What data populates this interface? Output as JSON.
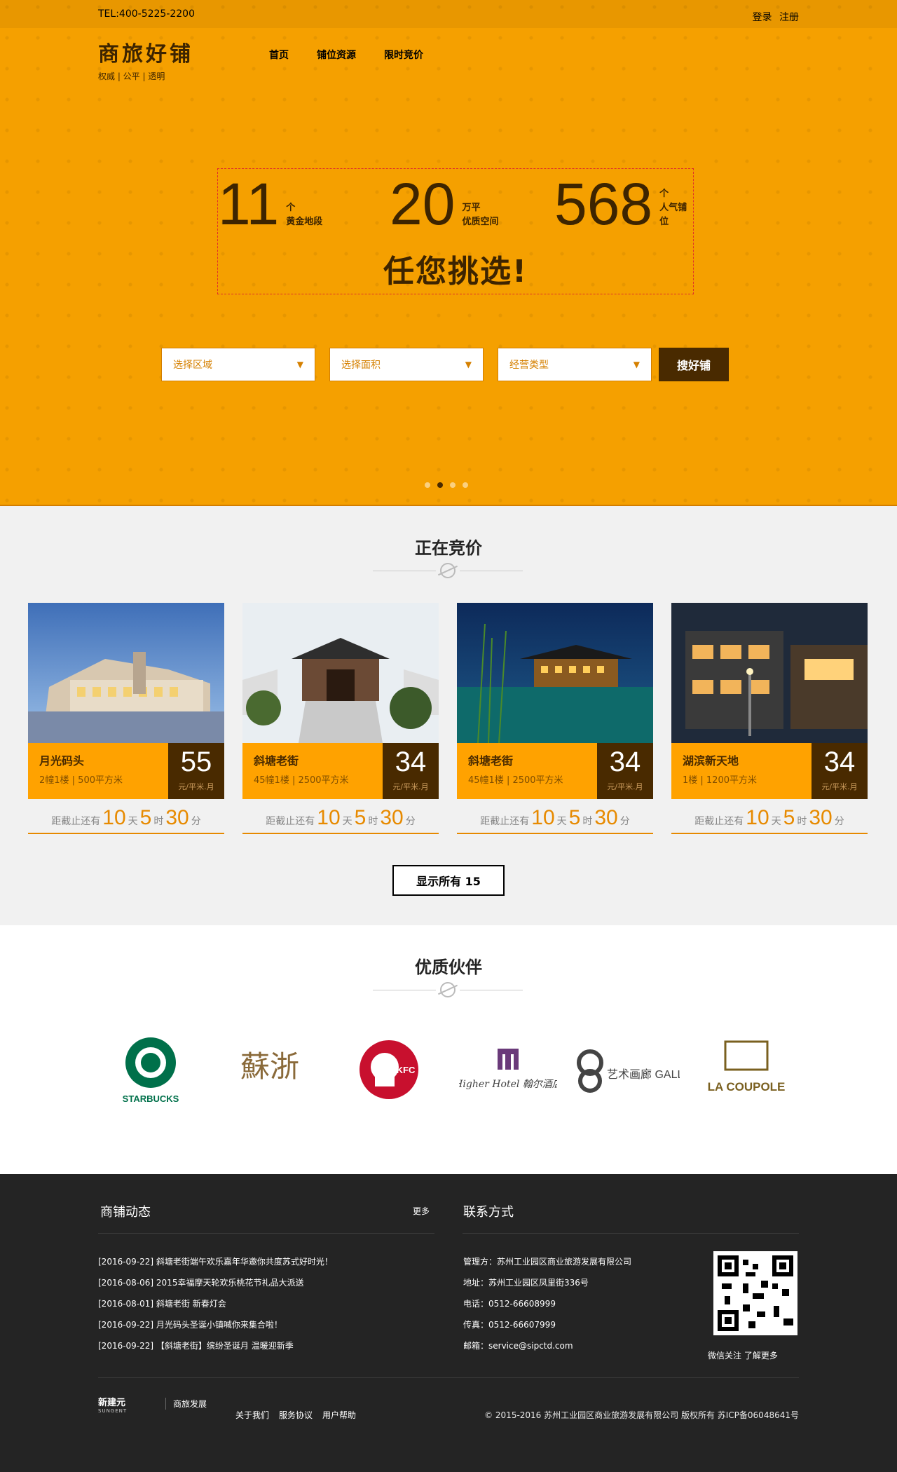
{
  "topbar": {
    "tel": "TEL:400-5225-2200",
    "login": "登录",
    "register": "注册"
  },
  "logo": {
    "main": "商旅好铺",
    "sub": "权威 | 公平 | 透明"
  },
  "nav": [
    "首页",
    "铺位资源",
    "限时竞价"
  ],
  "stats": [
    {
      "num": "11",
      "unit": "个",
      "label": "黄金地段"
    },
    {
      "num": "20",
      "unit": "万平",
      "label": "优质空间"
    },
    {
      "num": "568",
      "unit": "个",
      "label": "人气铺位"
    }
  ],
  "slogan": "任您挑选!",
  "search": {
    "area": "选择区域",
    "size": "选择面积",
    "type": "经营类型",
    "button": "搜好铺"
  },
  "auction": {
    "title": "正在竞价",
    "show_all": "显示所有 15"
  },
  "cards": [
    {
      "name": "月光码头",
      "meta": "2幢1楼 | 500平方米",
      "price": "55",
      "unit": "元/平米.月",
      "prefix": "距截止还有",
      "d": "10",
      "dl": "天",
      "h": "5",
      "hl": "时",
      "m": "30",
      "ml": "分"
    },
    {
      "name": "斜塘老街",
      "meta": "45幢1楼 | 2500平方米",
      "price": "34",
      "unit": "元/平米.月",
      "prefix": "距截止还有",
      "d": "10",
      "dl": "天",
      "h": "5",
      "hl": "时",
      "m": "30",
      "ml": "分"
    },
    {
      "name": "斜塘老街",
      "meta": "45幢1楼 | 2500平方米",
      "price": "34",
      "unit": "元/平米.月",
      "prefix": "距截止还有",
      "d": "10",
      "dl": "天",
      "h": "5",
      "hl": "时",
      "m": "30",
      "ml": "分"
    },
    {
      "name": "湖滨新天地",
      "meta": "1楼 | 1200平方米",
      "price": "34",
      "unit": "元/平米.月",
      "prefix": "距截止还有",
      "d": "10",
      "dl": "天",
      "h": "5",
      "hl": "时",
      "m": "30",
      "ml": "分"
    }
  ],
  "partners": {
    "title": "优质伙伴",
    "logos": [
      "STARBUCKS",
      "蘇浙",
      "KFC",
      "Higher Hotel 翰尔酒店",
      "艺术画廊 GALLERY",
      "LA COUPOLE"
    ]
  },
  "footer": {
    "news_title": "商铺动态",
    "more": "更多",
    "contact_title": "联系方式",
    "news": [
      "[2016-09-22] 斜塘老街端午欢乐嘉年华邀你共度苏式好时光！",
      "[2016-08-06] 2015幸福摩天轮欢乐桃花节礼品大派送",
      "[2016-08-01] 斜塘老街 新春灯会",
      "[2016-09-22] 月光码头圣诞小镇喊你来集合啦！",
      "[2016-09-22] 【斜塘老街】缤纷圣诞月 温暖迎新季"
    ],
    "contact": [
      "管理方：苏州工业园区商业旅游发展有限公司",
      "地址：苏州工业园区凤里街336号",
      "电话：0512-66608999",
      "传真：0512-66607999",
      "邮箱：service@sipctd.com"
    ],
    "qr_caption": "微信关注 了解更多",
    "brand1": "新建元",
    "brand1_sub": "SUNGENT",
    "brand2": "商旅发展",
    "links": [
      "关于我们",
      "服务协议",
      "用户帮助"
    ],
    "copyright": "© 2015-2016 苏州工业园区商业旅游发展有限公司 版权所有 苏ICP备06048641号"
  }
}
